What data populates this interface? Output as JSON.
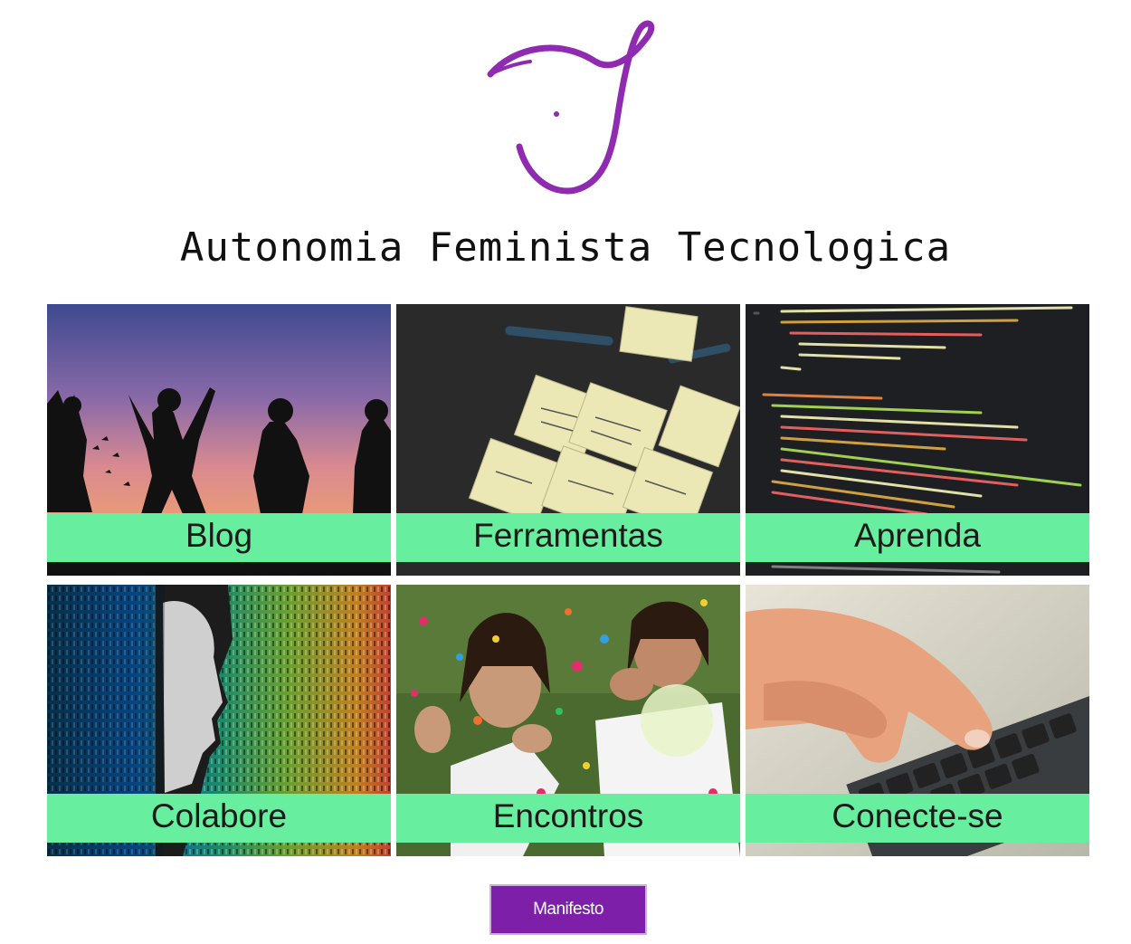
{
  "header": {
    "logo_icon": "purple-ribbon-j-logo-icon",
    "title": "Autonomia Feminista Tecnologica"
  },
  "colors": {
    "accent_purple": "#8f2bb0",
    "label_bar_green": "#67ee9f",
    "button_purple": "#7d1fa8"
  },
  "tiles": [
    {
      "label": "Blog",
      "image": "women-dancing-silhouettes-sunset"
    },
    {
      "label": "Ferramentas",
      "image": "sticky-notes-wireframes"
    },
    {
      "label": "Aprenda",
      "image": "code-editor-screen"
    },
    {
      "label": "Colabore",
      "image": "woman-profile-binary-code"
    },
    {
      "label": "Encontros",
      "image": "women-blowing-confetti"
    },
    {
      "label": "Conecte-se",
      "image": "hand-on-keyboard"
    }
  ],
  "manifesto_button": {
    "label": "Manifesto"
  }
}
